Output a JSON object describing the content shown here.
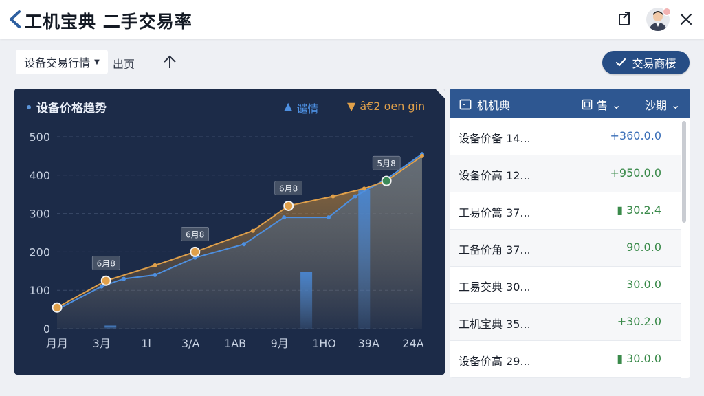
{
  "header": {
    "title": "工机宝典 二手交易率"
  },
  "toolbar": {
    "filter_label": "设备交易行情",
    "home_label": "出页",
    "trade_button_label": "交易商棲"
  },
  "chart": {
    "title": "设备价格趋势",
    "legend": [
      {
        "marker": "▲",
        "label": "谴情",
        "color": "#4d8fe0"
      },
      {
        "marker": "▼",
        "label": "â€2 oen gin",
        "color": "#e0a04a"
      }
    ]
  },
  "chart_data": {
    "type": "line",
    "title": "设备价格趋势",
    "categories": [
      "月月",
      "3月",
      "1l",
      "3/A",
      "1AB",
      "9月",
      "1HO",
      "39A",
      "24A"
    ],
    "ylim": [
      0,
      500
    ],
    "yticks": [
      0,
      100,
      200,
      300,
      400,
      500
    ],
    "grid": true,
    "legend_position": "top-right",
    "series": [
      {
        "name": "谴情",
        "color": "#4d8fe0",
        "x": [
          0,
          1,
          1.5,
          2.2,
          3.1,
          4.2,
          5.1,
          6.1,
          6.7,
          7.4,
          8.2
        ],
        "y": [
          50,
          110,
          130,
          140,
          185,
          220,
          290,
          290,
          345,
          390,
          455
        ]
      },
      {
        "name": "â€2 oen gin",
        "color": "#e0a04a",
        "x": [
          0,
          1.1,
          2.2,
          3.1,
          4.4,
          5.2,
          6.2,
          6.9,
          7.4,
          8.2
        ],
        "y": [
          55,
          125,
          165,
          200,
          255,
          320,
          345,
          365,
          385,
          450
        ]
      }
    ],
    "bars": [
      {
        "x": 1.2,
        "value": 8,
        "color": "#2f5f96"
      },
      {
        "x": 5.6,
        "value": 148,
        "color": "#3f74b8"
      },
      {
        "x": 6.9,
        "value": 362,
        "color": "#3f74b8"
      }
    ],
    "annotations": [
      {
        "x": 1.1,
        "y": 125,
        "label": "6月8",
        "marker_color": "#e0a04a"
      },
      {
        "x": 3.1,
        "y": 200,
        "label": "6月8",
        "marker_color": "#e0a04a"
      },
      {
        "x": 5.2,
        "y": 320,
        "label": "6月8",
        "marker_color": "#e0a04a"
      },
      {
        "x": 7.4,
        "y": 385,
        "label": "5月8",
        "marker_color": "#3b8a58"
      },
      {
        "x": 0,
        "y": 55,
        "label": "",
        "marker_color": "#e0a04a"
      }
    ]
  },
  "list": {
    "title": "机机典",
    "filter_a": "售",
    "filter_b": "沙期",
    "rows": [
      {
        "name": "设备价备 14...",
        "change": "+360.0.0",
        "color": "#3b6fb8"
      },
      {
        "name": "设备价高 12...",
        "change": "+950.0.0",
        "color": "#3a8a4a"
      },
      {
        "name": "工易价篙 37...",
        "change": "▮ 30.2.4",
        "color": "#3a8a4a"
      },
      {
        "name": "工备价角 37...",
        "change": "90.0.0",
        "color": "#3a8a4a"
      },
      {
        "name": "工易交典 30...",
        "change": "30.0.0",
        "color": "#3a8a4a"
      },
      {
        "name": "工机宝典 35...",
        "change": "+30.2.0",
        "color": "#3a8a4a"
      },
      {
        "name": "设备价高 29...",
        "change": "▮ 30.0.0",
        "color": "#3a8a4a"
      }
    ]
  }
}
